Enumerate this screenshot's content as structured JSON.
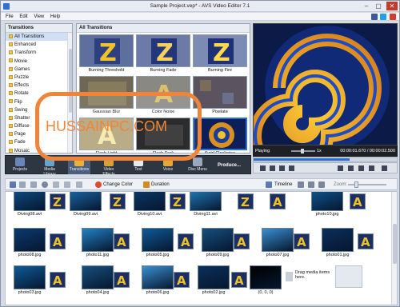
{
  "window": {
    "title": "Sample Project.vep* - AVS Video Editor 7.1"
  },
  "menu": [
    "File",
    "Edit",
    "View",
    "Help"
  ],
  "tree": {
    "header": "Transitions",
    "items": [
      "All Transitions",
      "Enhanced",
      "Transform",
      "Movie",
      "Games",
      "Puzzle",
      "Effects",
      "Rotate",
      "Flip",
      "Swing",
      "Shatter",
      "Diffuse",
      "Page",
      "Fade",
      "Mosaic"
    ],
    "selected_index": 0
  },
  "grid": {
    "header": "All Transitions",
    "items": [
      "Burning Threshold",
      "Burning Fade",
      "Burning Fire",
      "Gaussian Blur",
      "Color Noise",
      "Pixelate",
      "Flash Light",
      "Flash Dark",
      "Swirl Clockwise"
    ],
    "selected_index": 8
  },
  "preview": {
    "state": "Playing",
    "speed": "1x",
    "time": "00:00:01.670 / 00:00:02.500"
  },
  "toolbar": {
    "items": [
      "Projects",
      "Media Library",
      "Transitions",
      "Video Effects",
      "Text",
      "Voice",
      "Disc Menu"
    ],
    "selected_index": 2,
    "produce": "Produce..."
  },
  "library_bar": {
    "change_color": "Change Color",
    "duration": "Duration",
    "timeline": "Timeline",
    "zoom": "Zoom:"
  },
  "media": {
    "row1": [
      "Diving08.avi",
      "Diving09.avi",
      "Diving10.avi",
      "Diving11.avi",
      "photo10.jpg"
    ],
    "row2": [
      "photo08.jpg",
      "photo11.jpg",
      "photo05.jpg",
      "photo09.jpg",
      "photo07.jpg",
      "photo01.jpg"
    ],
    "row3": [
      "photo03.jpg",
      "photo04.jpg",
      "photo06.jpg",
      "photo02.jpg",
      "(0, 0, 0)"
    ],
    "drop_hint": "Drag media items here."
  },
  "watermark": "HUSSAINPC.COM",
  "colors": {
    "accent": "#2b6fd0",
    "watermark": "#f0853a",
    "toolbar": "#2e3642"
  }
}
